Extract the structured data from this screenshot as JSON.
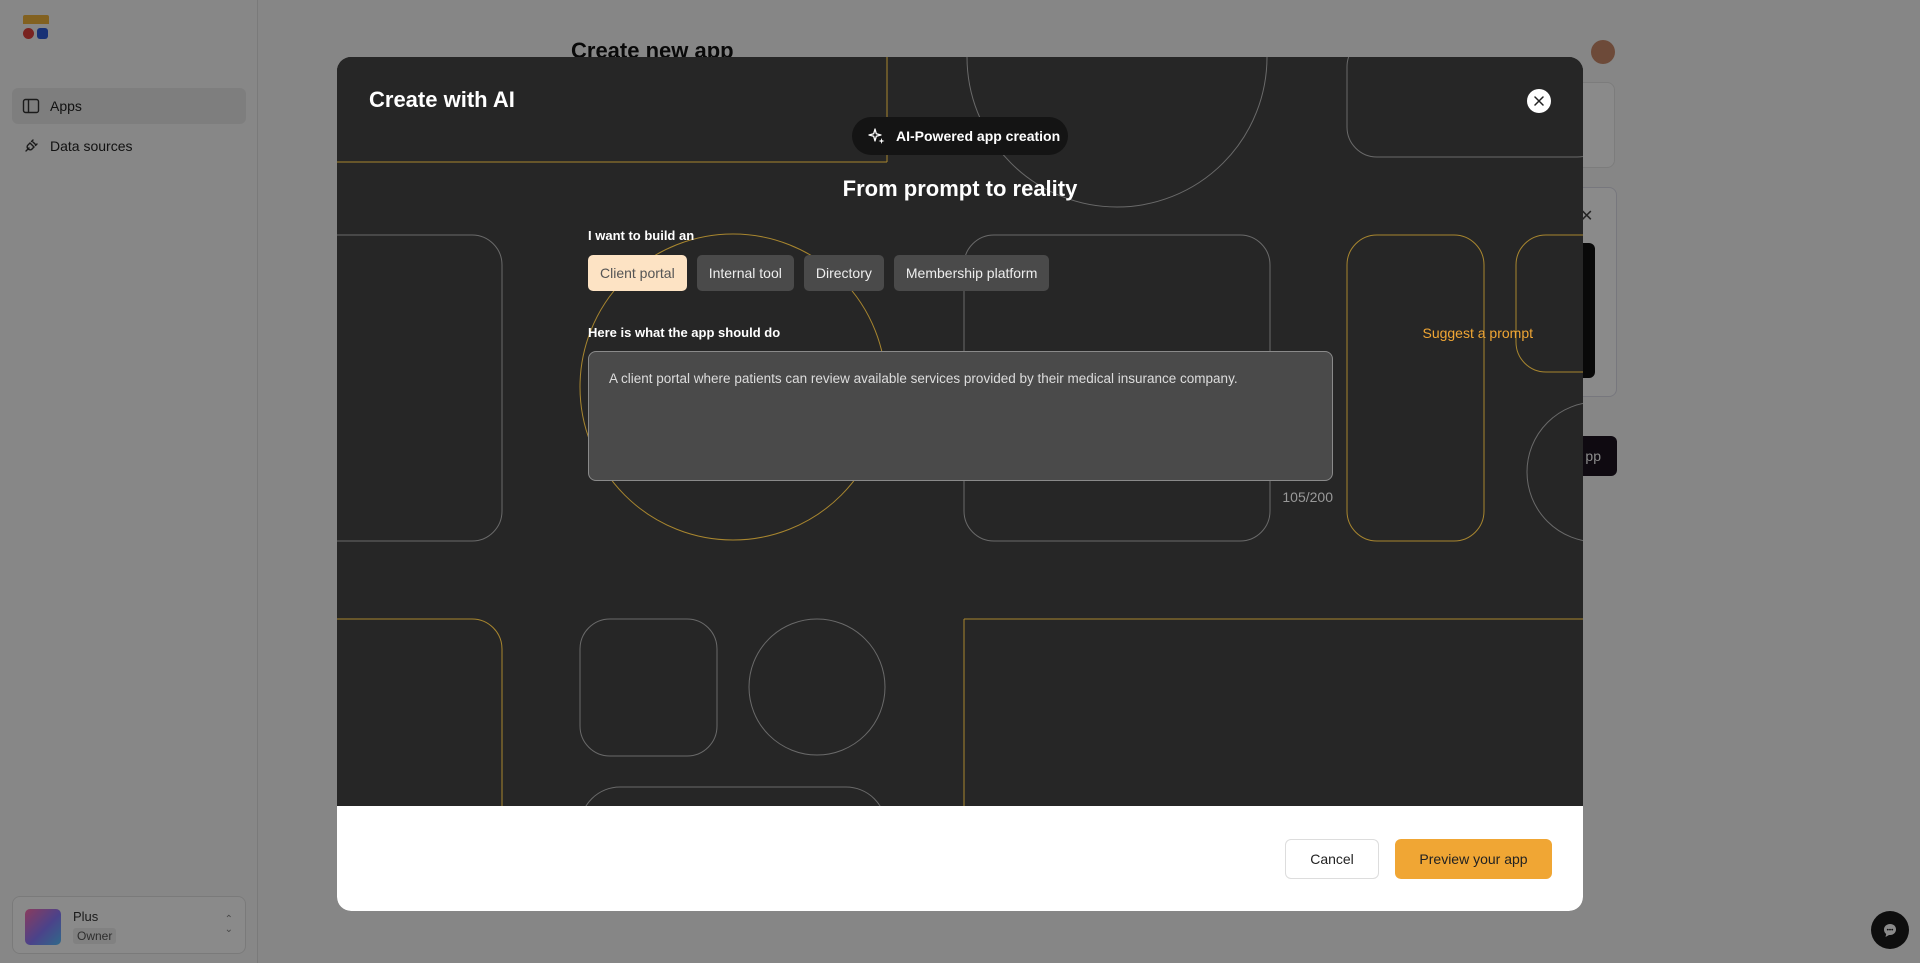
{
  "sidebar": {
    "items": [
      {
        "label": "Apps",
        "icon": "sidebar-panel-icon",
        "active": true
      },
      {
        "label": "Data sources",
        "icon": "plug-icon",
        "active": false
      }
    ],
    "account": {
      "plan": "Plus",
      "role": "Owner"
    }
  },
  "background": {
    "page_title": "Create new app",
    "button_fragment": "pp"
  },
  "modal": {
    "title": "Create with AI",
    "badge": "AI-Powered app creation",
    "headline": "From prompt to reality",
    "build_label": "I want to build an",
    "options": [
      {
        "label": "Client portal",
        "selected": true
      },
      {
        "label": "Internal tool",
        "selected": false
      },
      {
        "label": "Directory",
        "selected": false
      },
      {
        "label": "Membership platform",
        "selected": false
      }
    ],
    "prompt_label": "Here is what the app should do",
    "suggest_label": "Suggest a prompt",
    "prompt_value": "A client portal where patients can review available services provided by their medical insurance company.",
    "char_count": "105/200",
    "cancel_label": "Cancel",
    "preview_label": "Preview your app"
  },
  "colors": {
    "accent": "#f0a634",
    "modal_bg": "#262626",
    "chip_selected_bg": "#fde3c4"
  }
}
